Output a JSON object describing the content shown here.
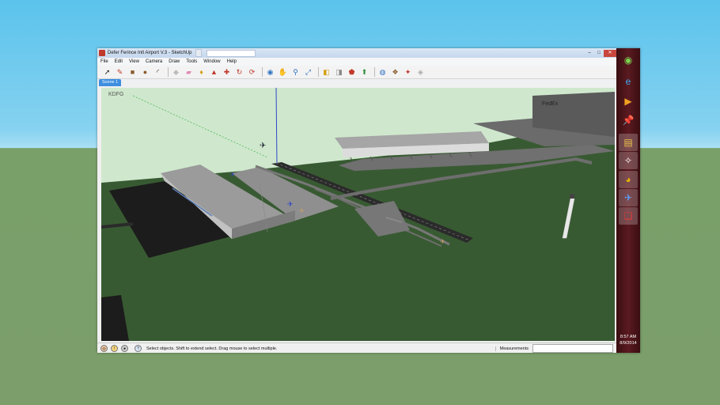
{
  "window": {
    "title": "Defer Ferince Intl Airport V.3 - SketchUp",
    "background_tab": "",
    "search_placeholder": "",
    "btn_minimize": "–",
    "btn_maximize": "□",
    "btn_close": "✕"
  },
  "menu": [
    "File",
    "Edit",
    "View",
    "Camera",
    "Draw",
    "Tools",
    "Window",
    "Help"
  ],
  "toolbar_icons": [
    {
      "name": "select-tool-icon",
      "glyph": "➚",
      "color": "#222"
    },
    {
      "name": "pencil-tool-icon",
      "glyph": "✎",
      "color": "#c0392b"
    },
    {
      "name": "rectangle-tool-icon",
      "glyph": "■",
      "color": "#8a5a2b"
    },
    {
      "name": "circle-tool-icon",
      "glyph": "●",
      "color": "#8a5a2b"
    },
    {
      "name": "arc-tool-icon",
      "glyph": "◜",
      "color": "#222"
    },
    {
      "name": "make-component-icon",
      "glyph": "◆",
      "color": "#bbbbbb"
    },
    {
      "name": "eraser-tool-icon",
      "glyph": "▰",
      "color": "#e08ab0"
    },
    {
      "name": "paint-bucket-icon",
      "glyph": "♦",
      "color": "#d4a017"
    },
    {
      "name": "push-pull-icon",
      "glyph": "▲",
      "color": "#c0392b"
    },
    {
      "name": "move-tool-icon",
      "glyph": "✚",
      "color": "#c0392b"
    },
    {
      "name": "rotate-tool-icon",
      "glyph": "↻",
      "color": "#c0392b"
    },
    {
      "name": "offset-tool-icon",
      "glyph": "⟳",
      "color": "#c0392b"
    },
    {
      "name": "orbit-tool-icon",
      "glyph": "◉",
      "color": "#2e6fc0"
    },
    {
      "name": "pan-tool-icon",
      "glyph": "✋",
      "color": "#555"
    },
    {
      "name": "zoom-tool-icon",
      "glyph": "⚲",
      "color": "#2e6fc0"
    },
    {
      "name": "zoom-extents-icon",
      "glyph": "⤢",
      "color": "#2e6fc0"
    },
    {
      "name": "previous-view-icon",
      "glyph": "◧",
      "color": "#d4a017"
    },
    {
      "name": "next-view-icon",
      "glyph": "◨",
      "color": "#888"
    },
    {
      "name": "get-models-icon",
      "glyph": "⬟",
      "color": "#c0392b"
    },
    {
      "name": "share-model-icon",
      "glyph": "⬆",
      "color": "#2e8b3a"
    },
    {
      "name": "google-earth-icon",
      "glyph": "◍",
      "color": "#2e6fc0"
    },
    {
      "name": "extension-warehouse-icon",
      "glyph": "❖",
      "color": "#8a5a2b"
    },
    {
      "name": "components-icon",
      "glyph": "✦",
      "color": "#c0392b"
    },
    {
      "name": "styles-icon",
      "glyph": "◈",
      "color": "#aaaaaa"
    }
  ],
  "scene_tab": "Scene 1",
  "viewport": {
    "model_label": "KDFG",
    "building_sign": "FedEx"
  },
  "status": {
    "text": "Select objects. Shift to extend select. Drag mouse to select multiple.",
    "measurements_label": "Measurements",
    "measurements_value": ""
  },
  "taskbar": {
    "icons": [
      {
        "name": "start-button-icon",
        "glyph": "◉",
        "color": "#7ad34f"
      },
      {
        "name": "internet-explorer-icon",
        "glyph": "e",
        "color": "#3fa9f5"
      },
      {
        "name": "media-player-icon",
        "glyph": "▶",
        "color": "#f0a020"
      },
      {
        "name": "pinned-app-icon",
        "glyph": "📌",
        "color": "#e03030"
      },
      {
        "name": "file-explorer-icon",
        "glyph": "▤",
        "color": "#e8c24a"
      },
      {
        "name": "compass-app-icon",
        "glyph": "✧",
        "color": "#ffffff"
      },
      {
        "name": "chrome-icon",
        "glyph": "◕",
        "color": "#e8b400"
      },
      {
        "name": "flight-app-icon",
        "glyph": "✈",
        "color": "#5aa0ff"
      },
      {
        "name": "sketchup-icon",
        "glyph": "❏",
        "color": "#e23a3a"
      }
    ],
    "time": "8:57 AM",
    "date": "8/9/2014"
  }
}
